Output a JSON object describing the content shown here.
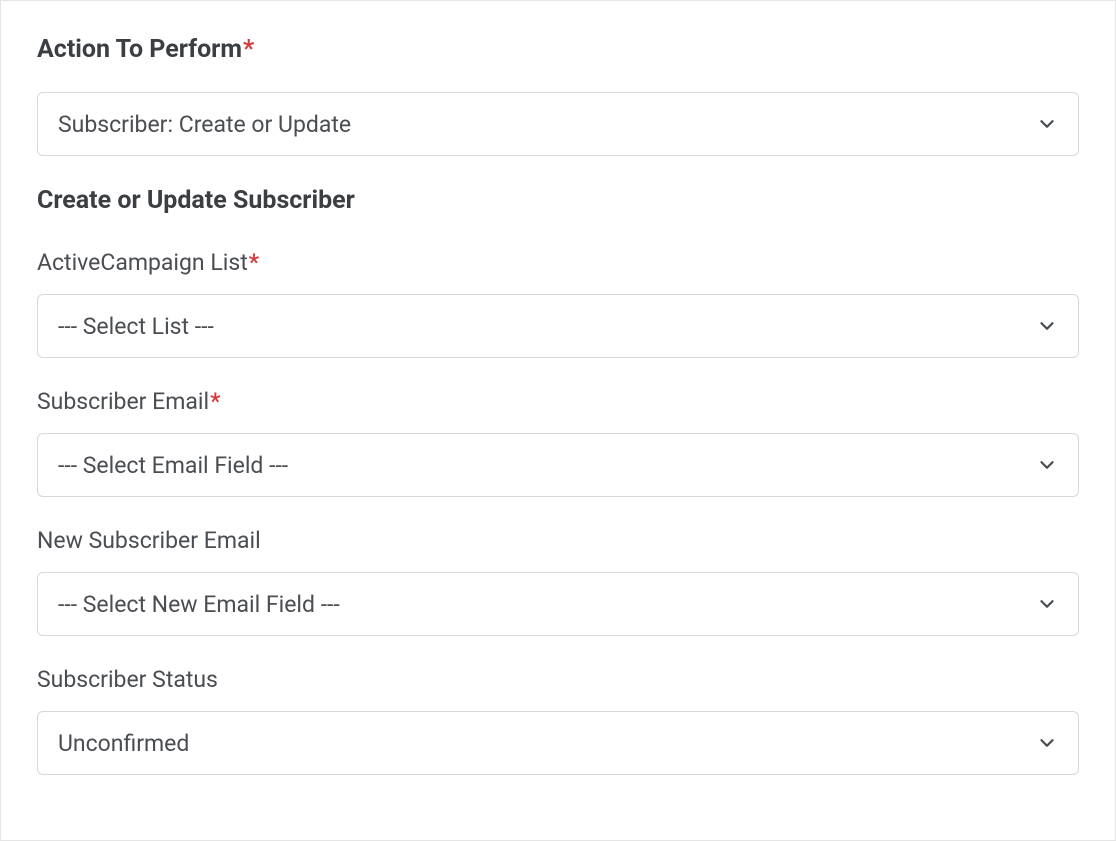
{
  "action": {
    "label": "Action To Perform",
    "required_marker": "*",
    "value": "Subscriber: Create or Update"
  },
  "subsection_title": "Create or Update Subscriber",
  "fields": {
    "list": {
      "label": "ActiveCampaign List",
      "required_marker": "*",
      "value": "--- Select List ---"
    },
    "email": {
      "label": "Subscriber Email",
      "required_marker": "*",
      "value": "--- Select Email Field ---"
    },
    "new_email": {
      "label": "New Subscriber Email",
      "value": "--- Select New Email Field ---"
    },
    "status": {
      "label": "Subscriber Status",
      "value": "Unconfirmed"
    }
  }
}
